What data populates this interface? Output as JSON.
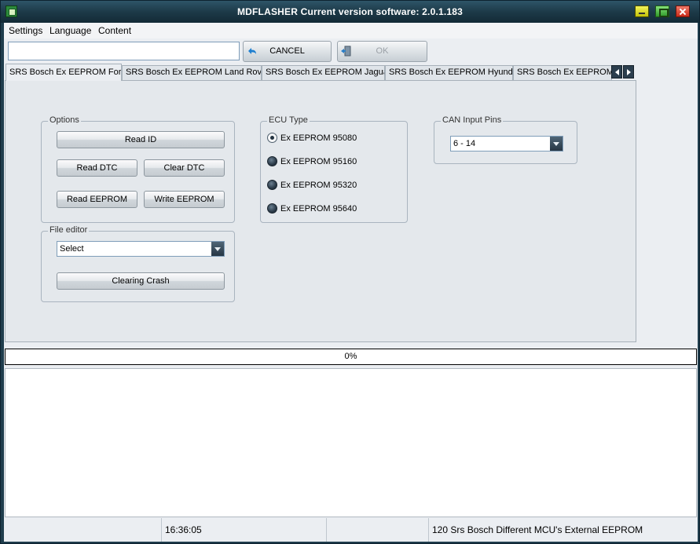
{
  "window": {
    "title": "MDFLASHER  Current version software: 2.0.1.183"
  },
  "menu": [
    "Settings",
    "Language",
    "Content"
  ],
  "toolbar": {
    "input_value": "",
    "cancel_label": "CANCEL",
    "ok_label": "OK"
  },
  "tabs": [
    {
      "label": "SRS Bosch Ex EEPROM Ford",
      "active": true
    },
    {
      "label": "SRS Bosch Ex EEPROM Land Rover",
      "active": false
    },
    {
      "label": "SRS Bosch Ex EEPROM Jaguar",
      "active": false
    },
    {
      "label": "SRS Bosch Ex EEPROM Hyundai",
      "active": false
    },
    {
      "label": "SRS Bosch Ex EEPROM M",
      "active": false
    }
  ],
  "options": {
    "title": "Options",
    "read_id": "Read ID",
    "read_dtc": "Read DTC",
    "clear_dtc": "Clear DTC",
    "read_eeprom": "Read EEPROM",
    "write_eeprom": "Write EEPROM"
  },
  "file_editor": {
    "title": "File editor",
    "select_value": "Select",
    "clearing_crash": "Clearing Crash"
  },
  "ecu_type": {
    "title": "ECU Type",
    "items": [
      {
        "label": "Ex EEPROM 95080",
        "checked": true
      },
      {
        "label": "Ex EEPROM 95160",
        "checked": false
      },
      {
        "label": "Ex EEPROM 95320",
        "checked": false
      },
      {
        "label": "Ex EEPROM 95640",
        "checked": false
      }
    ]
  },
  "can_input": {
    "title": "CAN Input Pins",
    "value": "6 - 14"
  },
  "progress": {
    "text": "0%",
    "fraction": 0
  },
  "status": {
    "time": "16:36:05",
    "description": "120 Srs Bosch Different MCU's External EEPROM"
  },
  "colors": {
    "titlebar": "#1d3a48",
    "client_bg": "#ebeef2",
    "panel_bg": "#e4e8ec"
  }
}
